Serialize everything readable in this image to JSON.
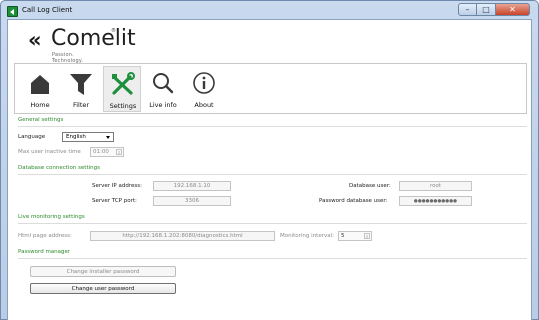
{
  "window": {
    "title": "Call Log Client",
    "controls": {
      "minimize": "–",
      "maximize": "□",
      "close": "✕"
    }
  },
  "logo": {
    "mark": "«",
    "word": "Comelit",
    "sup": "®",
    "tagline": "Passion. Technology. Design."
  },
  "toolbar": {
    "items": [
      {
        "label": "Home",
        "icon": "home-icon"
      },
      {
        "label": "Filter",
        "icon": "filter-icon"
      },
      {
        "label": "Settings",
        "icon": "settings-tools-icon",
        "active": true
      },
      {
        "label": "Live info",
        "icon": "magnifier-icon"
      },
      {
        "label": "About",
        "icon": "info-icon"
      }
    ]
  },
  "general": {
    "heading": "General settings",
    "language_label": "Language",
    "language_value": "English",
    "max_inactive_label": "Max user inactive time",
    "max_inactive_value": "01:00"
  },
  "database": {
    "heading": "Database connection settings",
    "server_ip_label": "Server IP address:",
    "server_ip_value": "192.168.1.10",
    "server_port_label": "Server TCP port:",
    "server_port_value": "3306",
    "db_user_label": "Database user:",
    "db_user_value": "root",
    "db_password_label": "Password database user:",
    "db_password_value": "●●●●●●●●●●●"
  },
  "live": {
    "heading": "Live monitoring settings",
    "html_page_label": "Html page address:",
    "html_page_value": "http://192.168.1.202:8080/diagnostics.html",
    "interval_label": "Monitoring interval:",
    "interval_value": "5"
  },
  "password": {
    "heading": "Password manager",
    "installer_button": "Change installer password",
    "user_button": "Change user password"
  },
  "colors": {
    "section_heading": "#2b8a2b",
    "title_bar": "#c9d9ee"
  }
}
